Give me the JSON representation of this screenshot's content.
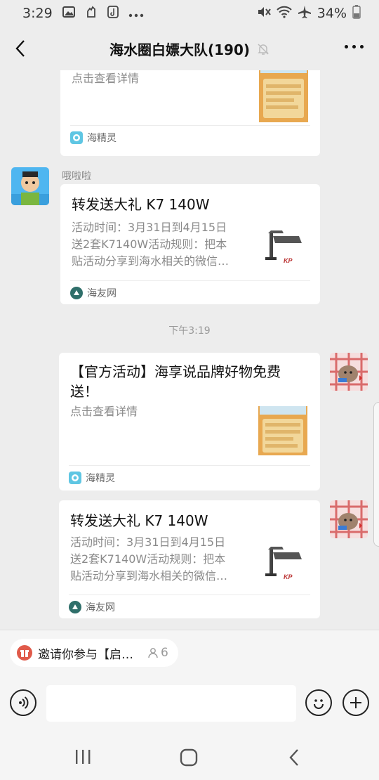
{
  "status_bar": {
    "time": "3:29",
    "battery": "34%"
  },
  "header": {
    "title": "海水圈白嫖大队(190)"
  },
  "messages": [
    {
      "kind": "card",
      "desc_line1": "点击查看详情",
      "source": "海精灵"
    },
    {
      "kind": "card",
      "sender": "哦啦啦",
      "title": "转发送大礼 K7 140W",
      "desc_line1": "活动时间：3月31日到4月15日",
      "desc_line2": "送2套K7140W活动规则：把本",
      "desc_line3": "贴活动分享到海水相关的微信…",
      "source": "海友网"
    },
    {
      "kind": "time",
      "time": "下午3:19"
    },
    {
      "kind": "card",
      "title_line1": "【官方活动】海享说品牌好物免费",
      "title_line2": "送！",
      "desc_line1": "点击查看详情",
      "source": "海精灵"
    },
    {
      "kind": "card",
      "title": "转发送大礼 K7 140W",
      "desc_line1": "活动时间：3月31日到4月15日",
      "desc_line2": "送2套K7140W活动规则：把本",
      "desc_line3": "贴活动分享到海水相关的微信…",
      "source": "海友网"
    }
  ],
  "thumb_text": "KP",
  "invite": {
    "label": "邀请你参与【启…",
    "count": "6"
  },
  "input": {
    "placeholder": ""
  },
  "colors": {
    "background": "#ededed",
    "card": "#ffffff",
    "accent_red": "#e05a4a"
  }
}
